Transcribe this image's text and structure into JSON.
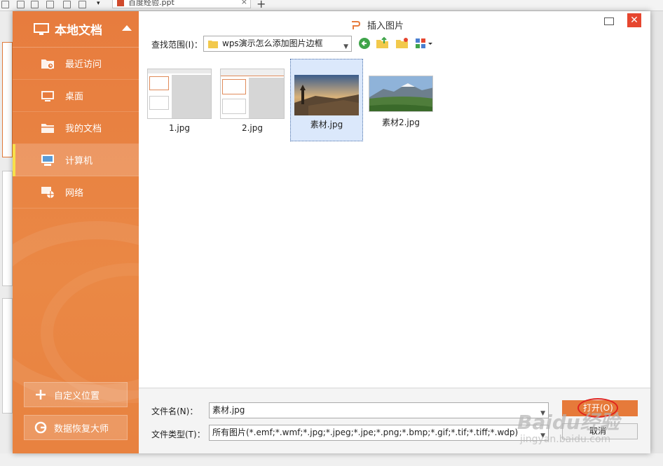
{
  "background_app": {
    "doc_tab": "百度经验.ppt",
    "new_tab_symbol": "+"
  },
  "sidebar": {
    "header": "本地文档",
    "items": [
      {
        "label": "最近访问",
        "icon": "recent-folder-icon"
      },
      {
        "label": "桌面",
        "icon": "desktop-icon"
      },
      {
        "label": "我的文档",
        "icon": "folder-icon"
      },
      {
        "label": "计算机",
        "icon": "computer-icon",
        "active": true
      },
      {
        "label": "网络",
        "icon": "network-icon"
      }
    ],
    "custom_location": "自定义位置",
    "data_recovery": "数据恢复大师"
  },
  "dialog": {
    "title": "插入图片",
    "look_in_label": "查找范围(I)：",
    "look_in_value": "wps演示怎么添加图片边框",
    "close_symbol": "✕"
  },
  "files": [
    {
      "name": "1.jpg",
      "kind": "slide"
    },
    {
      "name": "2.jpg",
      "kind": "slide"
    },
    {
      "name": "素材.jpg",
      "kind": "photo-sunset",
      "selected": true
    },
    {
      "name": "素材2.jpg",
      "kind": "photo-mountain"
    }
  ],
  "bottom": {
    "filename_label": "文件名(N)：",
    "filename_value": "素材.jpg",
    "filetype_label": "文件类型(T)：",
    "filetype_value": "所有图片(*.emf;*.wmf;*.jpg;*.jpeg;*.jpe;*.png;*.bmp;*.gif;*.tif;*.tiff;*.wdp)",
    "open_button": "打开(O)",
    "cancel_button": "取消"
  },
  "watermark": {
    "main": "Baidu经验",
    "sub": "jingyan.baidu.com"
  },
  "colors": {
    "sidebar_orange": "#e77c3e",
    "open_button": "#e67a3a",
    "close_button": "#e6462f",
    "selection": "#dbe8fb"
  }
}
